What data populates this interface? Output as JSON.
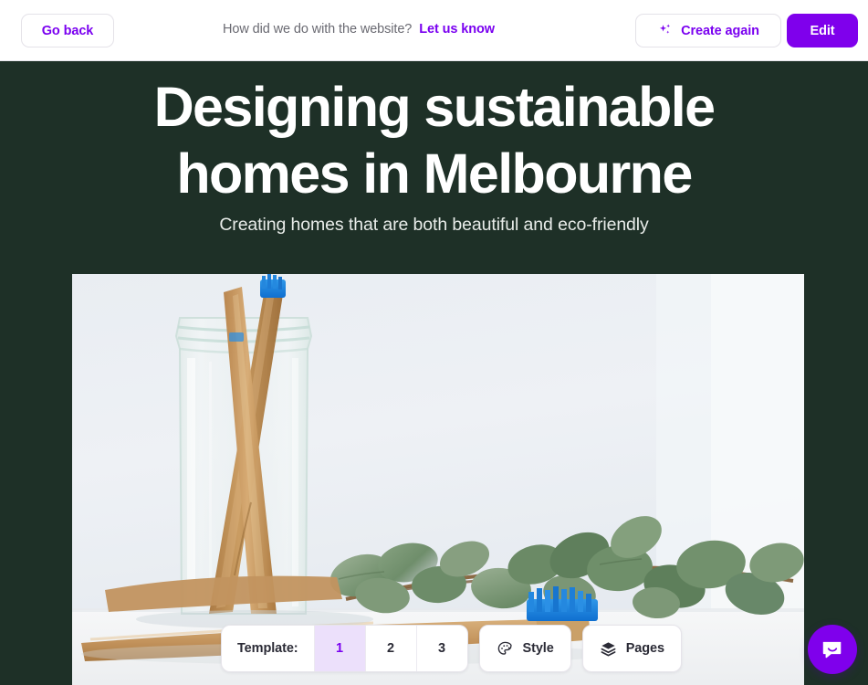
{
  "topbar": {
    "go_back_label": "Go back",
    "feedback_question": "How did we do with the website?",
    "feedback_link": "Let us know",
    "create_again_label": "Create again",
    "create_again_icon": "sparkles-icon",
    "edit_label": "Edit"
  },
  "hero": {
    "title": "Designing sustainable homes in Melbourne",
    "subtitle": "Creating homes that are both beautiful and eco-friendly",
    "image_alt": "Bamboo toothbrushes in a glass jar with eucalyptus leaves"
  },
  "toolbar": {
    "template_label": "Template:",
    "template_options": [
      "1",
      "2",
      "3"
    ],
    "template_selected": "1",
    "style_label": "Style",
    "style_icon": "palette-icon",
    "pages_label": "Pages",
    "pages_icon": "layers-icon"
  },
  "chat": {
    "icon": "chat-bubble-icon"
  },
  "colors": {
    "accent_purple": "#7f00ec",
    "link_purple": "#7a00f0",
    "selected_chip_bg": "#ece0fb",
    "hero_background": "#1e3027",
    "topbar_background": "#ffffff",
    "topbar_border": "#e8e6ec",
    "muted_text": "#6a6a72"
  }
}
